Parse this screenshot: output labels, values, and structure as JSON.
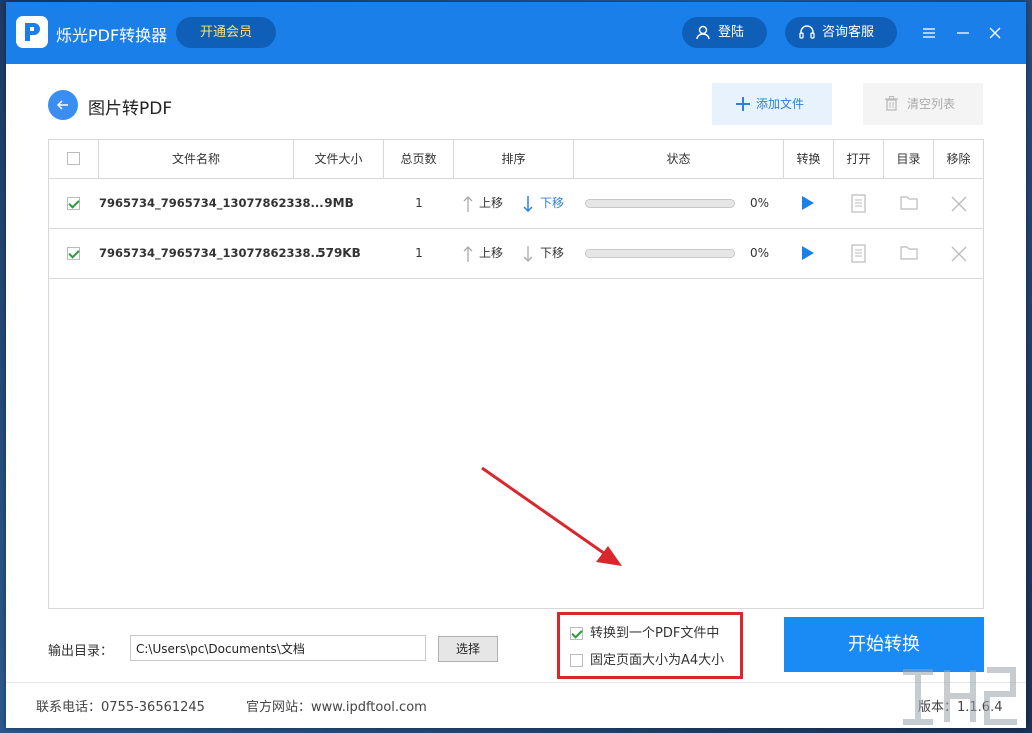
{
  "app": {
    "title": "烁光PDF转换器",
    "vip_label": "开通会员",
    "login_label": "登陆",
    "support_label": "咨询客服"
  },
  "page": {
    "title": "图片转PDF",
    "add_file_label": "添加文件",
    "clear_list_label": "清空列表"
  },
  "table": {
    "headers": {
      "filename": "文件名称",
      "filesize": "文件大小",
      "pages": "总页数",
      "sort": "排序",
      "status": "状态",
      "convert": "转换",
      "open": "打开",
      "folder": "目录",
      "remove": "移除"
    },
    "rows": [
      {
        "checked": true,
        "filename": "7965734_7965734_13077862338...",
        "filesize": "9MB",
        "pages": "1",
        "move_up": "上移",
        "move_down": "下移",
        "progress": 0,
        "percent": "0%"
      },
      {
        "checked": true,
        "filename": "7965734_7965734_13077862338...",
        "filesize": "579KB",
        "pages": "1",
        "move_up": "上移",
        "move_down": "下移",
        "progress": 0,
        "percent": "0%"
      }
    ]
  },
  "bottom": {
    "output_label": "输出目录：",
    "output_path": "C:\\Users\\pc\\Documents\\文档",
    "choose_label": "选择",
    "option_merge": "转换到一个PDF文件中",
    "option_merge_checked": true,
    "option_a4": "固定页面大小为A4大小",
    "option_a4_checked": false,
    "start_label": "开始转换"
  },
  "footer": {
    "phone": "联系电话：0755-36561245",
    "website": "官方网站：www.ipdftool.com",
    "version": "版本：1.1.6.4"
  },
  "colors": {
    "brand_blue": "#1a7fe8",
    "accent_blue": "#2d7fe0",
    "annotation_red": "#d9272e"
  }
}
